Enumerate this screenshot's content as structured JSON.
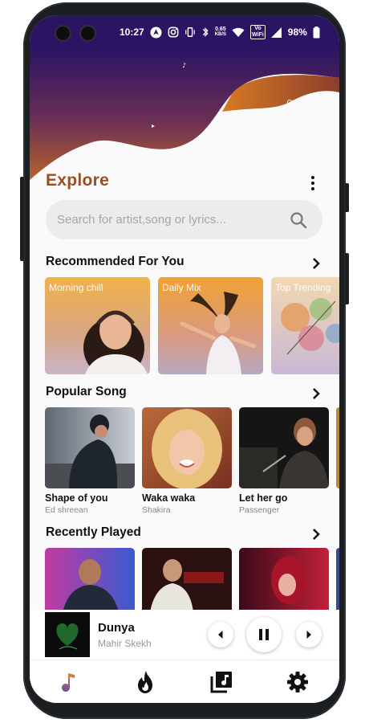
{
  "status_bar": {
    "time": "10:27",
    "speed_value": "0.65",
    "speed_unit": "KB/S",
    "wifi_badge_top": "Vo",
    "wifi_badge_bottom": "WiFi",
    "battery": "98%"
  },
  "header": {
    "title": "Explore",
    "gradient_top": "#2a1463",
    "gradient_bottom": "#e58a1f"
  },
  "search": {
    "placeholder": "Search for artist,song or lyrics..."
  },
  "recommended": {
    "title": "Recommended For You",
    "cards": [
      {
        "label": "Morning chill"
      },
      {
        "label": "Daily Mix"
      },
      {
        "label": "Top Trending"
      }
    ]
  },
  "popular": {
    "title": "Popular Song",
    "songs": [
      {
        "title": "Shape of you",
        "artist": "Ed shreean"
      },
      {
        "title": "Waka waka",
        "artist": "Shakira"
      },
      {
        "title": "Let her go",
        "artist": "Passenger"
      }
    ]
  },
  "recent": {
    "title": "Recently Played"
  },
  "player": {
    "title": "Dunya",
    "artist": "Mahir Skekh"
  },
  "nav": {
    "items": [
      "music-note-icon",
      "flame-icon",
      "library-music-icon",
      "gear-icon"
    ],
    "active_color": "#7d55a8"
  }
}
